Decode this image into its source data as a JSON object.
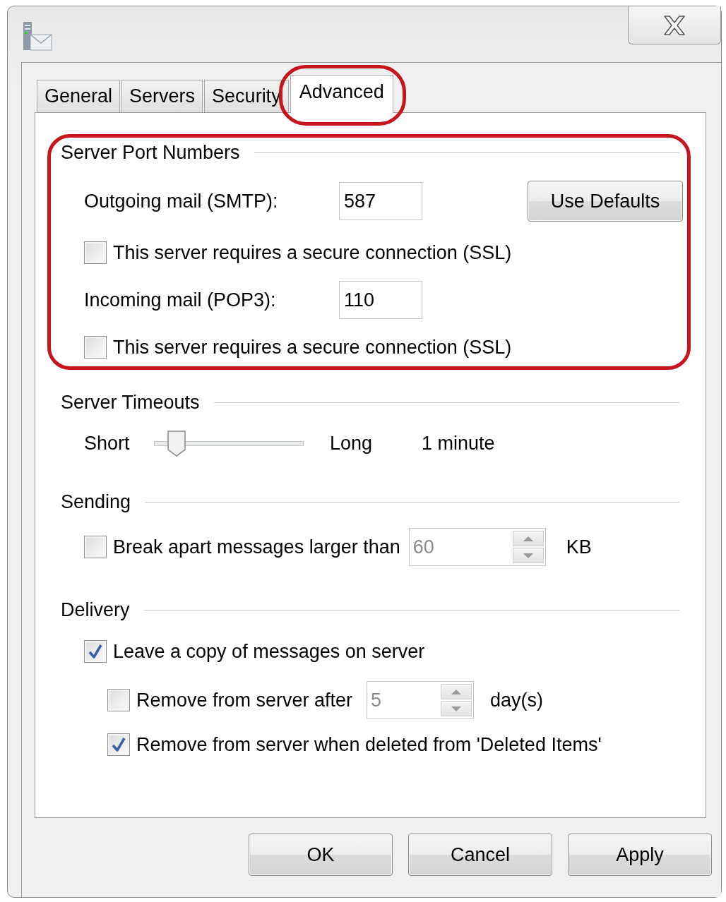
{
  "tabs": [
    {
      "label": "General",
      "selected": false,
      "highlighted": false
    },
    {
      "label": "Servers",
      "selected": false,
      "highlighted": false
    },
    {
      "label": "Security",
      "selected": false,
      "highlighted": false
    },
    {
      "label": "Advanced",
      "selected": true,
      "highlighted": true
    }
  ],
  "port_numbers": {
    "title": "Server Port Numbers",
    "highlighted": true,
    "outgoing": {
      "label": "Outgoing mail (SMTP):",
      "value": "587"
    },
    "outgoing_ssl": {
      "label": "This server requires a secure connection (SSL)",
      "checked": false
    },
    "incoming": {
      "label": "Incoming mail (POP3):",
      "value": "110"
    },
    "incoming_ssl": {
      "label": "This server requires a secure connection (SSL)",
      "checked": false
    },
    "use_defaults": "Use Defaults"
  },
  "timeouts": {
    "title": "Server Timeouts",
    "short": "Short",
    "long": "Long",
    "level": 0.15,
    "reading": "1 minute"
  },
  "sending": {
    "title": "Sending",
    "break_apart": {
      "label": "Break apart messages larger than",
      "checked": false
    },
    "size": {
      "value": "60",
      "disabled": true
    },
    "unit": "KB"
  },
  "delivery": {
    "title": "Delivery",
    "leave_copy": {
      "label": "Leave a copy of messages on server",
      "checked": true
    },
    "remove_after": {
      "label": "Remove from server after",
      "checked": false
    },
    "days": {
      "value": "5",
      "disabled": true
    },
    "days_unit": "day(s)",
    "remove_deleted": {
      "label": "Remove from server when deleted from 'Deleted Items'",
      "checked": true
    }
  },
  "buttons": [
    "OK",
    "Cancel",
    "Apply"
  ]
}
